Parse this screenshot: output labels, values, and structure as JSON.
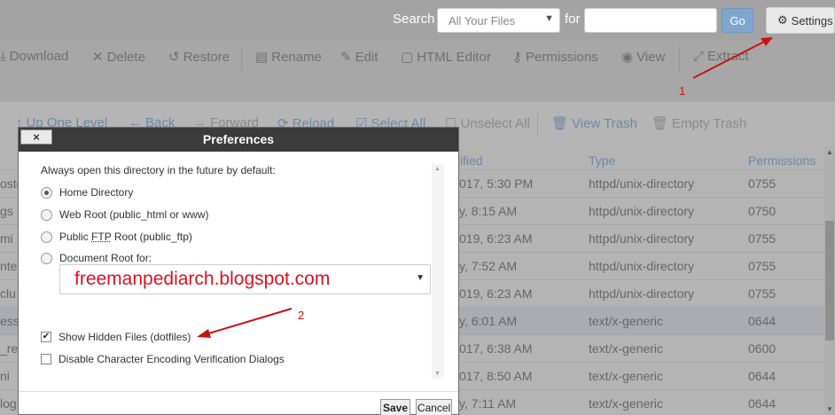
{
  "topbar": {
    "search_label": "Search",
    "scope_value": "All Your Files",
    "for_label": "for",
    "go_label": "Go",
    "settings_label": "Settings"
  },
  "toolbar": {
    "items": [
      {
        "label": "Download",
        "icon": "download-icon"
      },
      {
        "label": "Delete",
        "icon": "delete-icon"
      },
      {
        "label": "Restore",
        "icon": "restore-icon"
      },
      {
        "label": "Rename",
        "icon": "rename-icon"
      },
      {
        "label": "Edit",
        "icon": "edit-icon"
      },
      {
        "label": "HTML Editor",
        "icon": "html-editor-icon"
      },
      {
        "label": "Permissions",
        "icon": "key-icon"
      },
      {
        "label": "View",
        "icon": "eye-icon"
      },
      {
        "label": "Extract",
        "icon": "extract-icon"
      }
    ]
  },
  "navbar": {
    "items": [
      {
        "label": "Up One Level"
      },
      {
        "label": "Back"
      },
      {
        "label": "Forward"
      },
      {
        "label": "Reload"
      },
      {
        "label": "Select All"
      },
      {
        "label": "Unselect All"
      },
      {
        "label": "View Trash"
      },
      {
        "label": "Empty Trash"
      }
    ]
  },
  "table": {
    "headers": {
      "modified": "ified",
      "type": "Type",
      "permissions": "Permissions"
    },
    "rows": [
      {
        "name": "oste",
        "modified": "017, 5:30 PM",
        "type": "httpd/unix-directory",
        "perms": "0755"
      },
      {
        "name": "gs",
        "modified": "y, 8:15 AM",
        "type": "httpd/unix-directory",
        "perms": "0750"
      },
      {
        "name": "mi",
        "modified": "019, 6:23 AM",
        "type": "httpd/unix-directory",
        "perms": "0755"
      },
      {
        "name": "nte",
        "modified": "y, 7:52 AM",
        "type": "httpd/unix-directory",
        "perms": "0755"
      },
      {
        "name": "clu",
        "modified": "019, 6:23 AM",
        "type": "httpd/unix-directory",
        "perms": "0755"
      },
      {
        "name": "ess",
        "modified": "y, 6:01 AM",
        "type": "text/x-generic",
        "perms": "0644"
      },
      {
        "name": "_res",
        "modified": "017, 6:38 AM",
        "type": "text/x-generic",
        "perms": "0600"
      },
      {
        "name": "ni",
        "modified": "017, 8:50 AM",
        "type": "text/x-generic",
        "perms": "0644"
      },
      {
        "name": "log",
        "modified": "y, 7:11 AM",
        "type": "text/x-generic",
        "perms": "0644"
      }
    ]
  },
  "modal": {
    "close_label": "×",
    "title": "Preferences",
    "intro": "Always open this directory in the future by default:",
    "options": {
      "home": "Home Directory",
      "webroot": "Web Root (public_html or www)",
      "ftp_pre": "Public ",
      "ftp_abbr": "FTP",
      "ftp_post": " Root (public_ftp)",
      "docroot": "Document Root for:"
    },
    "docroot_value": "freemanpediarch.blogspot.com",
    "show_hidden": "Show Hidden Files (dotfiles)",
    "disable_encoding": "Disable Character Encoding Verification Dialogs",
    "save_label": "Save",
    "cancel_label": "Cancel"
  },
  "annotations": {
    "first": "1",
    "second": "2",
    "color": "#cc1111"
  }
}
